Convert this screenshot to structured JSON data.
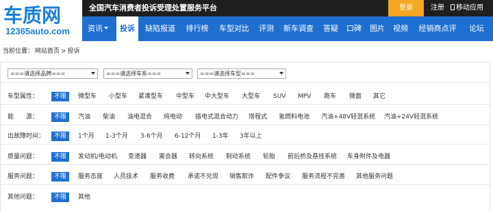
{
  "logo": {
    "main": "车质网",
    "sub": "12365auto.com"
  },
  "header": {
    "site_title": "全国汽车消费者投诉受理处置服务平台",
    "login": "登录",
    "register": "注册",
    "mobile": "移动应用"
  },
  "nav": [
    {
      "label": "资讯"
    },
    {
      "label": "投诉"
    },
    {
      "label": "缺陷报道"
    },
    {
      "label": "排行榜"
    },
    {
      "label": "车型对比"
    },
    {
      "label": "评测"
    },
    {
      "label": "新车调查"
    },
    {
      "label": "答疑"
    },
    {
      "label": "口碑"
    },
    {
      "label": "图片"
    },
    {
      "label": "视频"
    },
    {
      "label": "经销商点评"
    },
    {
      "label": "论坛"
    }
  ],
  "breadcrumb": {
    "prefix": "当前位置：",
    "home": "网站首页",
    "sep": ">",
    "current": "投诉"
  },
  "selects": [
    {
      "value": "===请选择品牌==="
    },
    {
      "value": "===请选择车系==="
    },
    {
      "value": "===请选择车型==="
    }
  ],
  "filters": {
    "car_type": {
      "label": "车型属性：",
      "options": [
        "不限",
        "微型车",
        "小型车",
        "紧凑型车",
        "中型车",
        "中大型车",
        "大型车",
        "SUV",
        "MPV",
        "跑车",
        "微面",
        "其它"
      ]
    },
    "energy": {
      "label": "能　　源：",
      "options": [
        "不限",
        "汽油",
        "柴油",
        "油电混合",
        "纯电动",
        "插电式混合动力",
        "增程式",
        "氢燃料电池",
        "汽油+48V轻混系统",
        "汽油+24V轻混系统"
      ]
    },
    "fault_time": {
      "label": "出故障时间：",
      "options": [
        "不限",
        "1个月",
        "1-3个月",
        "3-6个月",
        "6-12个月",
        "1-3年",
        "3年以上"
      ]
    },
    "quality": {
      "label": "质量问题：",
      "options": [
        "不限",
        "发动机/电动机",
        "变速器",
        "离合器",
        "转向系统",
        "制动系统",
        "轮胎",
        "前后桥及悬挂系统",
        "车身附件及电器"
      ]
    },
    "service": {
      "label": "服务问题：",
      "options": [
        "不限",
        "服务态度",
        "人员技术",
        "服务收费",
        "承诺不兑现",
        "销售欺诈",
        "配件争议",
        "服务流程不完善",
        "其他服务问题"
      ]
    },
    "other": {
      "label": "其他问题：",
      "options": [
        "不限",
        "其他"
      ]
    }
  },
  "colors": {
    "brand_blue": "#1f6fd0",
    "login_orange": "#f5a623",
    "title_dark": "#1f1f1f"
  }
}
